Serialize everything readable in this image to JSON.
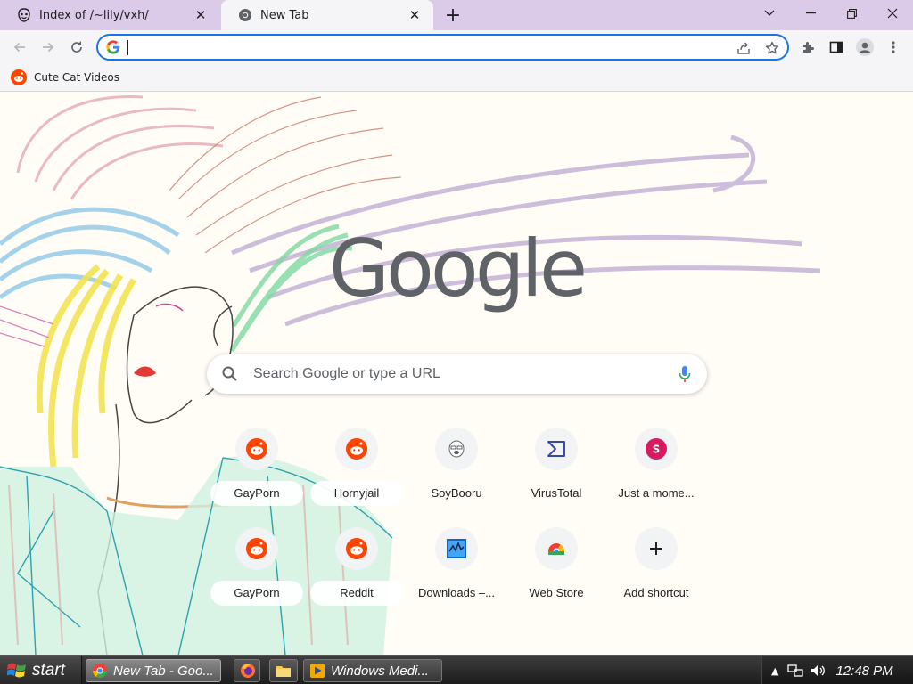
{
  "tabs": [
    {
      "title": "Index of /~lily/vxh/",
      "active": false,
      "icon": "mask-icon"
    },
    {
      "title": "New Tab",
      "active": true,
      "icon": "chrome-icon"
    }
  ],
  "omnibox": {
    "value": "",
    "placeholder": ""
  },
  "bookmarks": [
    {
      "label": "Cute Cat Videos",
      "icon": "reddit-icon"
    }
  ],
  "logo": "Google",
  "search": {
    "placeholder": "Search Google or type a URL"
  },
  "shortcuts": [
    {
      "label": "GayPorn",
      "icon": "reddit-icon"
    },
    {
      "label": "Hornyjail",
      "icon": "reddit-icon"
    },
    {
      "label": "SoyBooru",
      "icon": "soyjak-icon"
    },
    {
      "label": "VirusTotal",
      "icon": "virustotal-icon"
    },
    {
      "label": "Just a mome...",
      "icon": "s-letter-icon",
      "letter": "S"
    },
    {
      "label": "GayPorn",
      "icon": "reddit-icon"
    },
    {
      "label": "Reddit",
      "icon": "reddit-icon"
    },
    {
      "label": "Downloads –...",
      "icon": "downloads-icon"
    },
    {
      "label": "Web Store",
      "icon": "webstore-icon"
    },
    {
      "label": "Add shortcut",
      "icon": "plus-icon"
    }
  ],
  "taskbar": {
    "start": "start",
    "items": [
      {
        "label": "New Tab - Goo...",
        "icon": "chrome-icon"
      },
      {
        "label": "",
        "icon": "firefox-icon"
      },
      {
        "label": "",
        "icon": "folder-icon"
      },
      {
        "label": "Windows Medi...",
        "icon": "media-player-icon"
      }
    ],
    "clock": "12:48 PM"
  },
  "colors": {
    "tabstrip": "#dccbe8",
    "toolbar": "#f5f5f7",
    "accent": "#1a73e8",
    "reddit": "#ff4500"
  }
}
